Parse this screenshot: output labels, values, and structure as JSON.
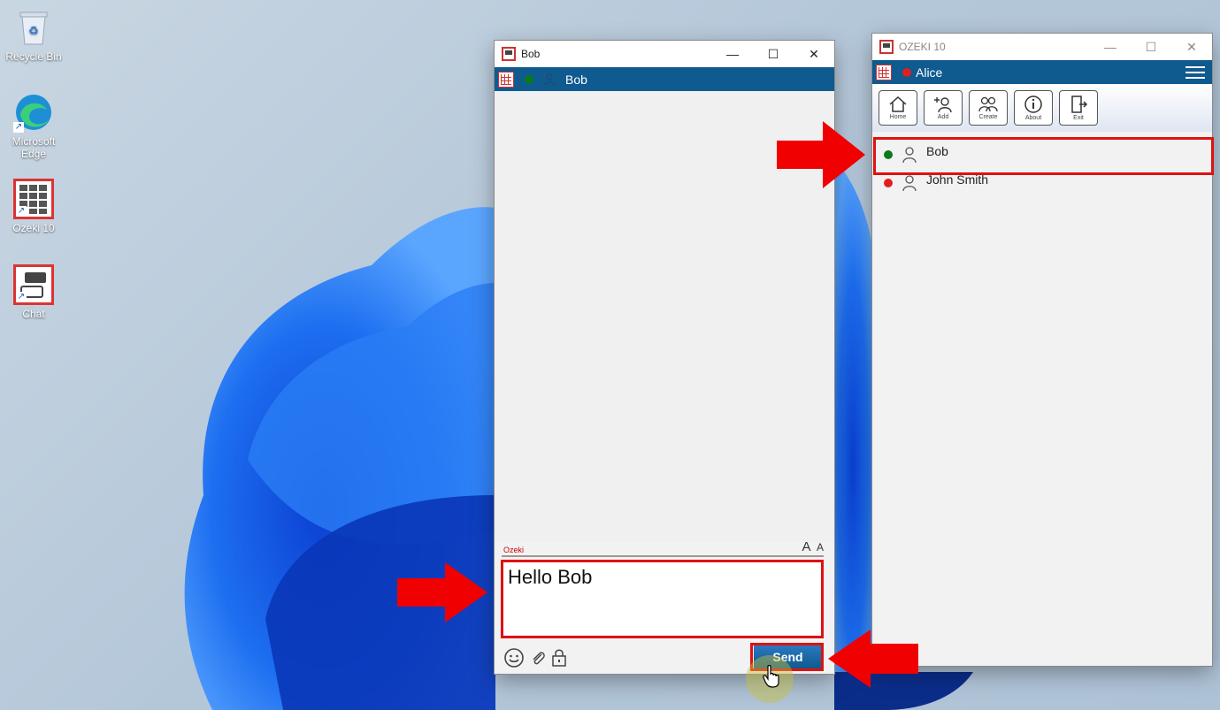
{
  "desktop": {
    "icons": [
      {
        "label": "Recycle Bin"
      },
      {
        "label": "Microsoft Edge"
      },
      {
        "label": "Ozeki 10"
      },
      {
        "label": "Chat"
      }
    ]
  },
  "chat_window": {
    "title": "Bob",
    "contact_name": "Bob",
    "contact_status_color": "#0a7a1a",
    "input_label": "Ozeki",
    "font_size_large": "A",
    "font_size_small": "A",
    "message_text": "Hello Bob",
    "send_label": "Send"
  },
  "main_window": {
    "title": "OZEKI 10",
    "user_name": "Alice",
    "user_status_color": "#e02020",
    "toolbar": [
      {
        "label": "Home",
        "icon": "home-icon"
      },
      {
        "label": "Add",
        "icon": "add-user-icon"
      },
      {
        "label": "Create",
        "icon": "create-group-icon"
      },
      {
        "label": "About",
        "icon": "info-icon"
      },
      {
        "label": "Exit",
        "icon": "exit-icon"
      }
    ],
    "contacts": [
      {
        "name": "Bob",
        "status_color": "#0a7a1a"
      },
      {
        "name": "John Smith",
        "status_color": "#e02020"
      }
    ]
  },
  "colors": {
    "accent_blue": "#0f5a8f",
    "highlight_red": "#e01010"
  }
}
